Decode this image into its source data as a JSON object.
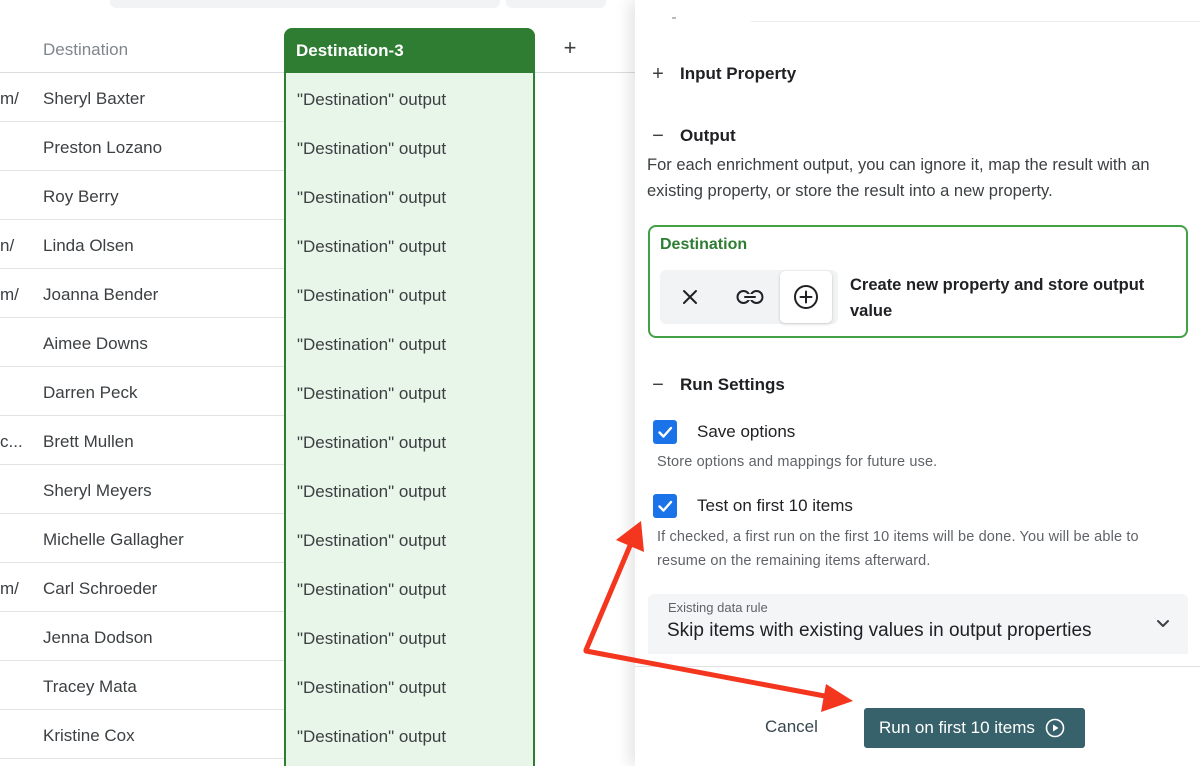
{
  "table": {
    "column_destination": "Destination",
    "column_destination_3": "Destination-3",
    "add_column": "+",
    "rows": [
      {
        "prefix": "m/",
        "name": "Sheryl Baxter",
        "output": "\"Destination\" output"
      },
      {
        "prefix": "",
        "name": "Preston Lozano",
        "output": "\"Destination\" output"
      },
      {
        "prefix": "",
        "name": "Roy Berry",
        "output": "\"Destination\" output"
      },
      {
        "prefix": "n/",
        "name": "Linda Olsen",
        "output": "\"Destination\" output"
      },
      {
        "prefix": "m/",
        "name": "Joanna Bender",
        "output": "\"Destination\" output"
      },
      {
        "prefix": "",
        "name": "Aimee Downs",
        "output": "\"Destination\" output"
      },
      {
        "prefix": "",
        "name": "Darren Peck",
        "output": "\"Destination\" output"
      },
      {
        "prefix": "c...",
        "name": "Brett Mullen",
        "output": "\"Destination\" output"
      },
      {
        "prefix": "",
        "name": "Sheryl Meyers",
        "output": "\"Destination\" output"
      },
      {
        "prefix": "",
        "name": "Michelle Gallagher",
        "output": "\"Destination\" output"
      },
      {
        "prefix": "m/",
        "name": "Carl Schroeder",
        "output": "\"Destination\" output"
      },
      {
        "prefix": "",
        "name": "Jenna Dodson",
        "output": "\"Destination\" output"
      },
      {
        "prefix": "",
        "name": "Tracey Mata",
        "output": "\"Destination\" output"
      },
      {
        "prefix": "",
        "name": "Kristine Cox",
        "output": "\"Destination\" output"
      }
    ]
  },
  "panel": {
    "input_property": {
      "toggle": "+",
      "title": "Input Property"
    },
    "output": {
      "toggle": "−",
      "title": "Output",
      "description": "For each enrichment output, you can ignore it, map the result with an existing property, or store the result into a new property."
    },
    "destination_card": {
      "title": "Destination",
      "modes": [
        {
          "icon": "close-icon",
          "active": false
        },
        {
          "icon": "link-icon",
          "active": false
        },
        {
          "icon": "add-circle-icon",
          "active": true
        }
      ],
      "selected_mode_label": "Create new property and store output value"
    },
    "run_settings": {
      "toggle": "−",
      "title": "Run Settings",
      "save_options": {
        "label": "Save options",
        "checked": true,
        "help": "Store options and mappings for future use."
      },
      "test_first": {
        "label": "Test on first 10 items",
        "checked": true,
        "help": "If checked, a first run on the first 10 items will be done. You will be able to resume on the remaining items afterward."
      },
      "existing_data_rule": {
        "label": "Existing data rule",
        "value": "Skip items with existing values in output properties"
      }
    },
    "footer": {
      "cancel": "Cancel",
      "run": "Run on first 10 items"
    }
  },
  "colors": {
    "accent_green": "#2e7d32",
    "column_fill": "#e8f5e9",
    "checkbox_blue": "#1a73e8",
    "run_button": "#37626b",
    "annotation_red": "#f4361f"
  }
}
